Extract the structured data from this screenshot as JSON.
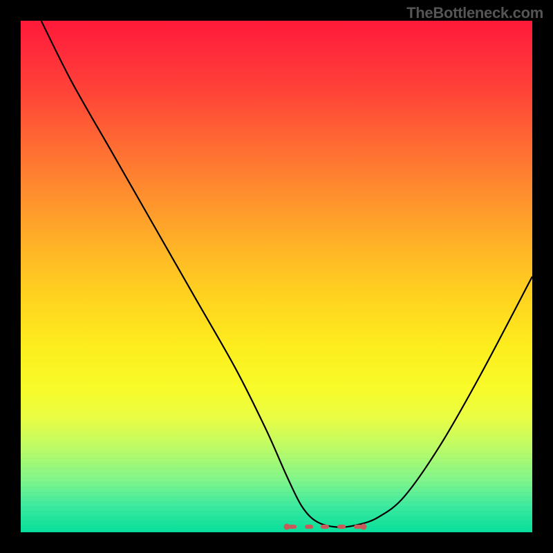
{
  "watermark": "TheBottleneck.com",
  "chart_data": {
    "type": "line",
    "title": "",
    "xlabel": "",
    "ylabel": "",
    "xlim": [
      0,
      100
    ],
    "ylim": [
      0,
      100
    ],
    "series": [
      {
        "name": "curve",
        "x": [
          4,
          10,
          18,
          26,
          34,
          42,
          48,
          52,
          55,
          58,
          62,
          66,
          70,
          75,
          82,
          90,
          100
        ],
        "values": [
          100,
          88,
          74,
          60,
          46,
          32,
          20,
          11,
          5,
          2,
          1,
          1.5,
          3,
          7,
          17,
          31,
          50
        ]
      }
    ],
    "highlight_band": {
      "x_start": 52,
      "x_end": 67,
      "color": "#c95a5a"
    },
    "background_gradient": {
      "top": "#ff1a3a",
      "middle": "#ffd31f",
      "bottom": "#07df9b"
    }
  }
}
